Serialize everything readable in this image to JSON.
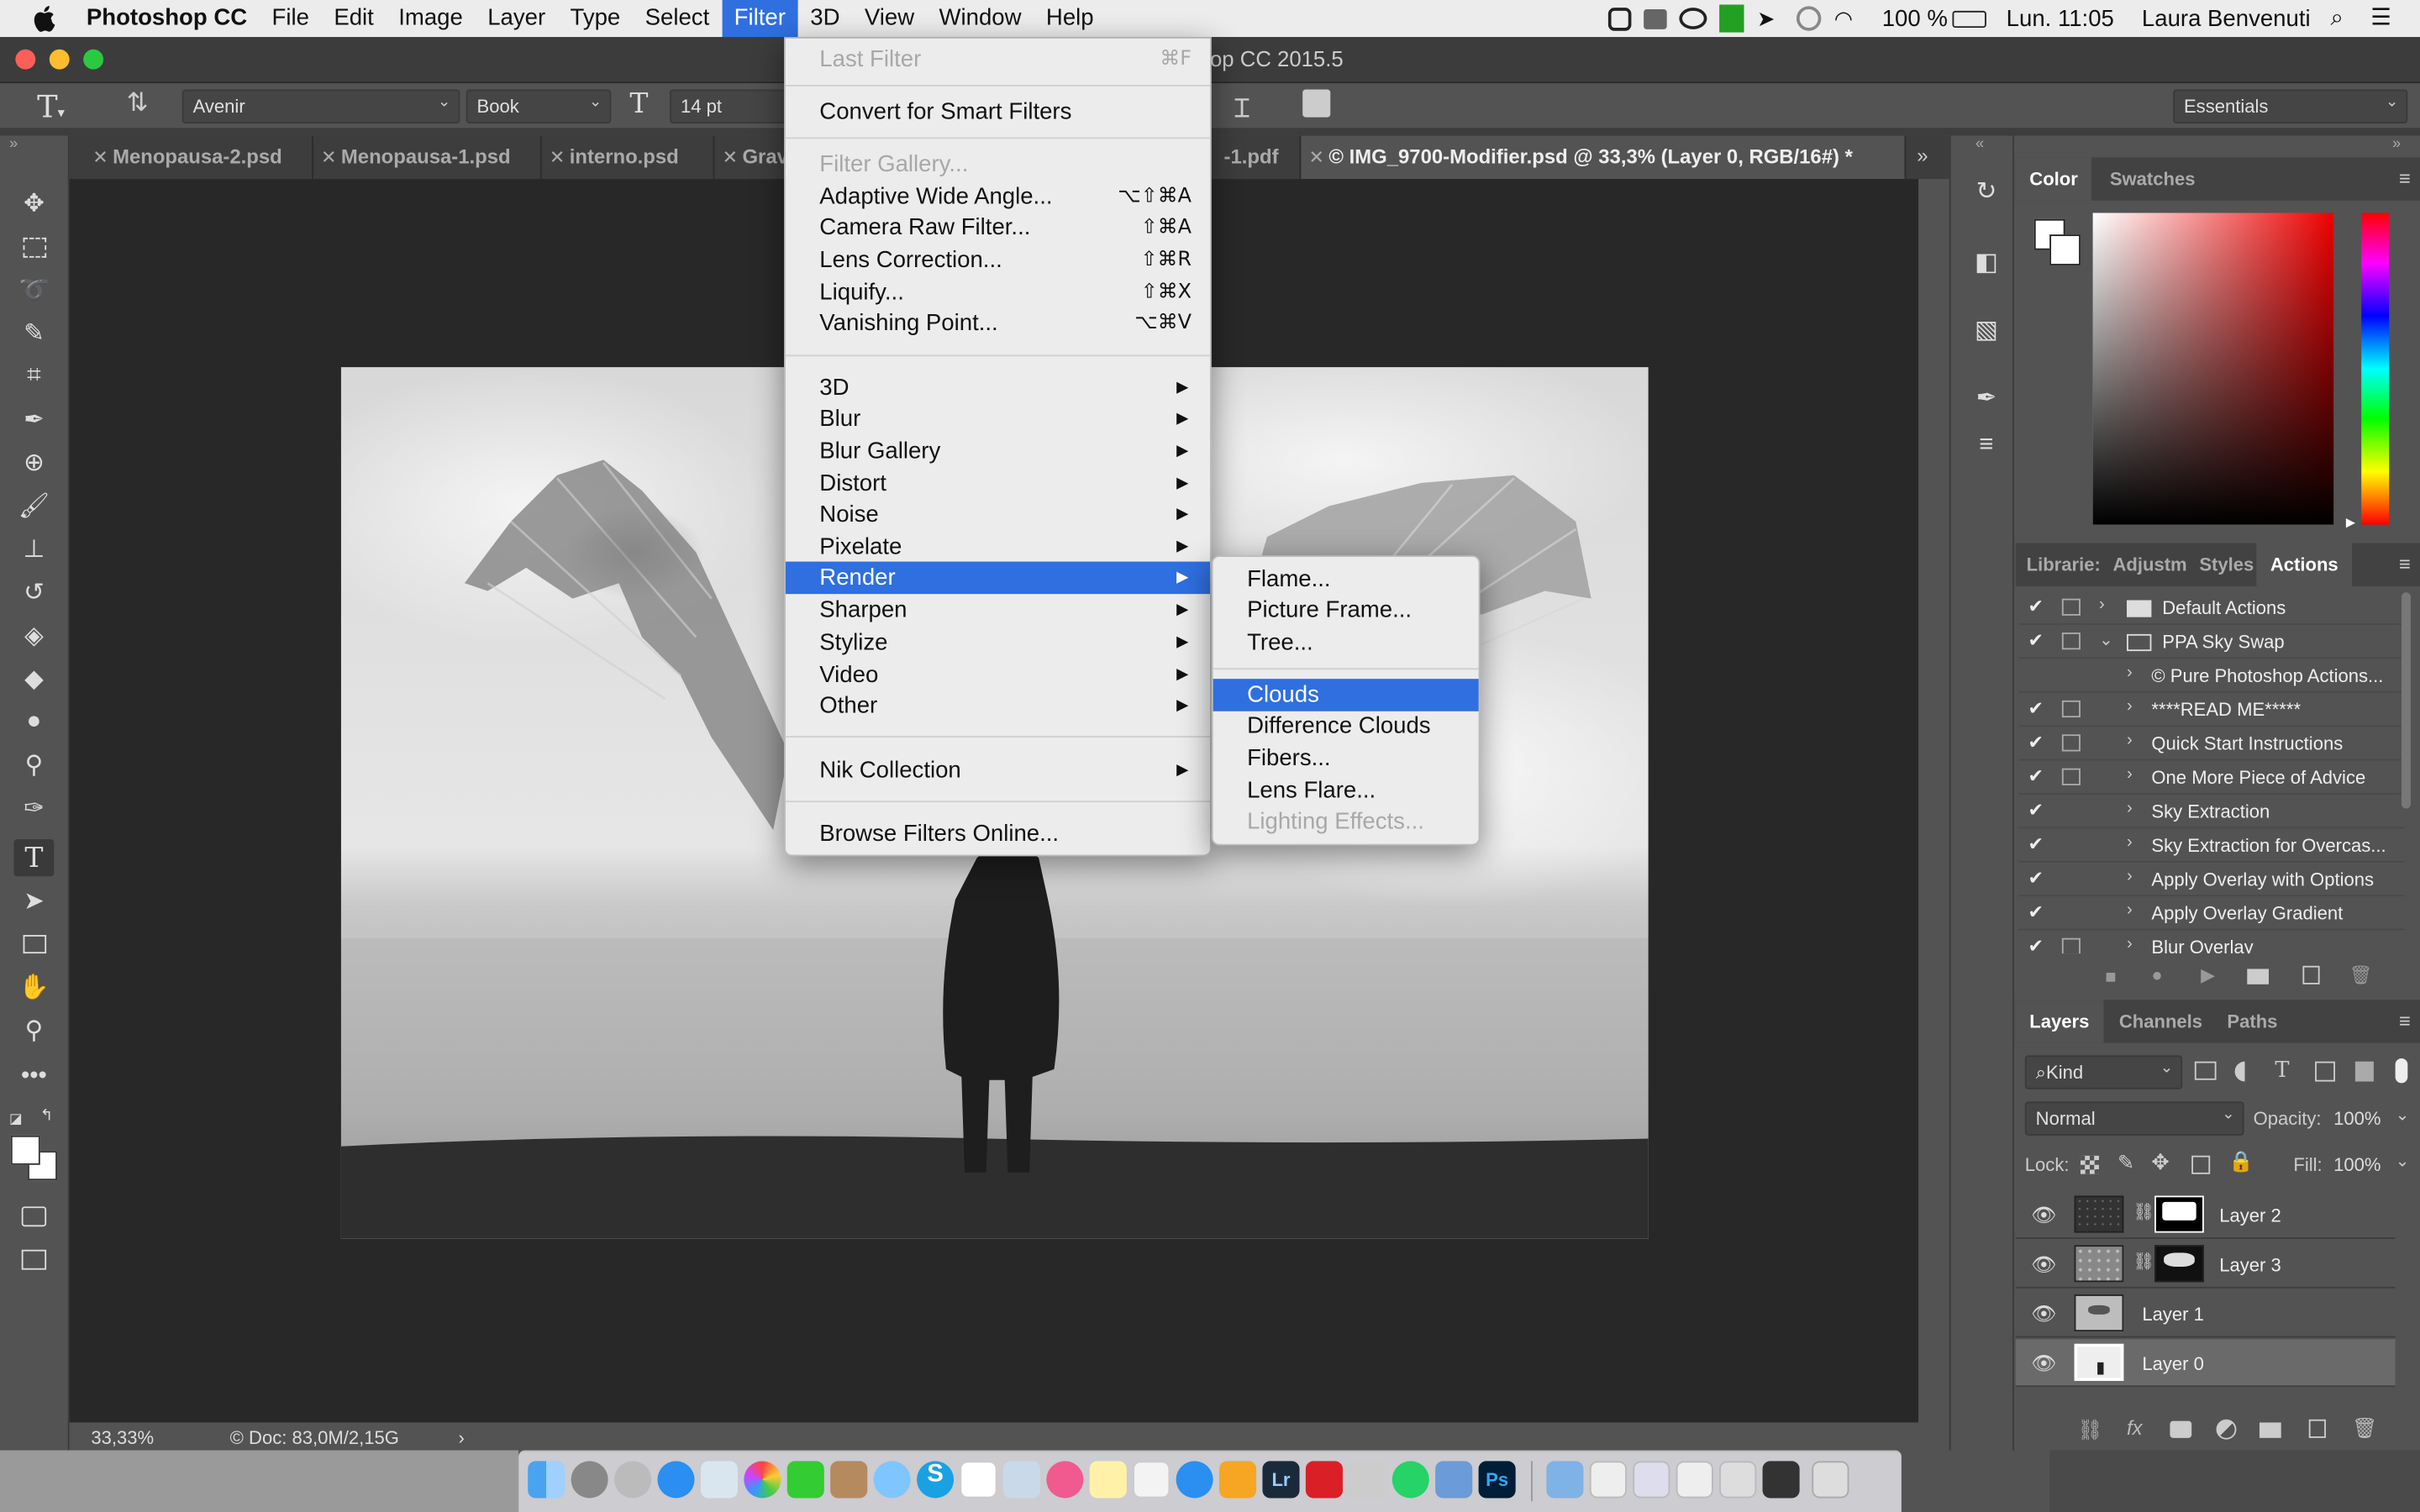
{
  "menubar": {
    "app_name": "Photoshop CC",
    "items": [
      "File",
      "Edit",
      "Image",
      "Layer",
      "Type",
      "Select",
      "Filter",
      "3D",
      "View",
      "Window",
      "Help"
    ],
    "active_item": "Filter",
    "battery": "100 %",
    "clock": "Lun. 11:05",
    "user": "Laura Benvenuti"
  },
  "window": {
    "title": "op CC 2015.5"
  },
  "options_bar": {
    "font_family": "Avenir",
    "font_style": "Book",
    "font_size": "14 pt",
    "workspace": "Essentials"
  },
  "tabs": [
    {
      "label": "Menopausa-2.psd"
    },
    {
      "label": "Menopausa-1.psd"
    },
    {
      "label": "interno.psd"
    },
    {
      "label": "Grav"
    },
    {
      "label": "-1.pdf"
    },
    {
      "label": "© IMG_9700-Modifier.psd @ 33,3% (Layer 0, RGB/16#) *",
      "active": true
    }
  ],
  "status_bar": {
    "zoom": "33,33%",
    "doc": "© Doc: 83,0M/2,15G"
  },
  "filter_menu": {
    "items": [
      {
        "label": "Last Filter",
        "shortcut": "⌘F",
        "disabled": true
      },
      {
        "label": "Convert for Smart Filters"
      },
      {
        "label": "Filter Gallery...",
        "disabled": true
      },
      {
        "label": "Adaptive Wide Angle...",
        "shortcut": "⌥⇧⌘A"
      },
      {
        "label": "Camera Raw Filter...",
        "shortcut": "⇧⌘A"
      },
      {
        "label": "Lens Correction...",
        "shortcut": "⇧⌘R"
      },
      {
        "label": "Liquify...",
        "shortcut": "⇧⌘X"
      },
      {
        "label": "Vanishing Point...",
        "shortcut": "⌥⌘V"
      },
      {
        "label": "3D",
        "submenu": true
      },
      {
        "label": "Blur",
        "submenu": true
      },
      {
        "label": "Blur Gallery",
        "submenu": true
      },
      {
        "label": "Distort",
        "submenu": true
      },
      {
        "label": "Noise",
        "submenu": true
      },
      {
        "label": "Pixelate",
        "submenu": true
      },
      {
        "label": "Render",
        "submenu": true,
        "highlighted": true
      },
      {
        "label": "Sharpen",
        "submenu": true
      },
      {
        "label": "Stylize",
        "submenu": true
      },
      {
        "label": "Video",
        "submenu": true
      },
      {
        "label": "Other",
        "submenu": true
      },
      {
        "label": "Nik Collection",
        "submenu": true
      },
      {
        "label": "Browse Filters Online..."
      }
    ]
  },
  "render_submenu": {
    "items": [
      {
        "label": "Flame..."
      },
      {
        "label": "Picture Frame..."
      },
      {
        "label": "Tree..."
      },
      {
        "label": "Clouds",
        "highlighted": true
      },
      {
        "label": "Difference Clouds"
      },
      {
        "label": "Fibers..."
      },
      {
        "label": "Lens Flare..."
      },
      {
        "label": "Lighting Effects...",
        "disabled": true
      }
    ]
  },
  "color_panel": {
    "tabs": [
      "Color",
      "Swatches"
    ],
    "active": "Color"
  },
  "actions_panel": {
    "tabs": [
      "Librarie:",
      "Adjustm",
      "Styles",
      "Actions"
    ],
    "active": "Actions",
    "rows": [
      {
        "name": "Default Actions",
        "checked": true,
        "dialog": true,
        "folder": true,
        "expanded": false
      },
      {
        "name": "PPA Sky Swap",
        "checked": true,
        "dialog": true,
        "folder": true,
        "expanded": true
      },
      {
        "name": "© Pure Photoshop Actions...",
        "checked": false,
        "dialog": false
      },
      {
        "name": "****READ ME*****",
        "checked": true,
        "dialog": true
      },
      {
        "name": "Quick Start Instructions",
        "checked": true,
        "dialog": true
      },
      {
        "name": "One More Piece of Advice",
        "checked": true,
        "dialog": true
      },
      {
        "name": "Sky Extraction",
        "checked": true,
        "dialog": false
      },
      {
        "name": "Sky Extraction for Overcas...",
        "checked": true,
        "dialog": false
      },
      {
        "name": "Apply Overlay with Options",
        "checked": true,
        "dialog": false
      },
      {
        "name": "Apply Overlay Gradient",
        "checked": true,
        "dialog": false
      },
      {
        "name": "Blur Overlay",
        "checked": true,
        "dialog": true
      }
    ]
  },
  "layers_panel": {
    "tabs": [
      "Layers",
      "Channels",
      "Paths"
    ],
    "active": "Layers",
    "kind_label": "Kind",
    "blend_mode": "Normal",
    "opacity_label": "Opacity:",
    "opacity": "100%",
    "lock_label": "Lock:",
    "fill_label": "Fill:",
    "fill": "100%",
    "layers": [
      {
        "name": "Layer 2",
        "mask": true
      },
      {
        "name": "Layer 3",
        "mask": true
      },
      {
        "name": "Layer 1",
        "mask": false
      },
      {
        "name": "Layer 0",
        "mask": false,
        "selected": true
      }
    ]
  },
  "colors": {
    "menu_highlight": "#2f6fdf",
    "panel_bg": "#535353",
    "canvas_bg": "#282828"
  }
}
